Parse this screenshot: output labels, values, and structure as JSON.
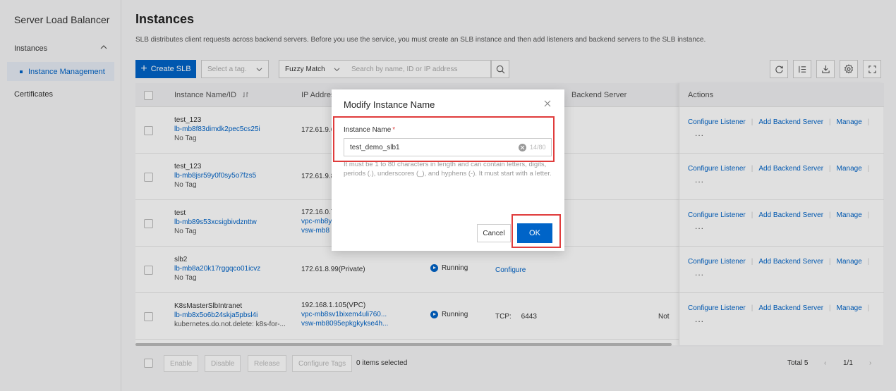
{
  "sidebar": {
    "title": "Server Load Balancer",
    "group": "Instances",
    "active_item": "Instance Management",
    "item_certificates": "Certificates"
  },
  "page": {
    "title": "Instances",
    "description": "SLB distributes client requests across backend servers. Before you use the service, you must create an SLB instance and then add listeners and backend servers to the SLB instance."
  },
  "toolbar": {
    "create_label": "Create SLB",
    "tag_placeholder": "Select a tag.",
    "match_mode": "Fuzzy Match",
    "search_placeholder": "Search by name, ID or IP address",
    "icons": [
      "refresh-icon",
      "columns-icon",
      "download-icon",
      "settings-icon",
      "fullscreen-icon"
    ]
  },
  "table": {
    "columns": [
      "Instance Name/ID",
      "IP Address",
      "Backend Server",
      "Actions"
    ],
    "rows": [
      {
        "name": "test_123",
        "id": "lb-mb8f83dimdk2pec5cs25i",
        "tag": "No Tag",
        "ip": [
          "172.61.9.6"
        ],
        "status": "",
        "backend": ""
      },
      {
        "name": "test_123",
        "id": "lb-mb8jsr59y0f0sy5o7fzs5",
        "tag": "No Tag",
        "ip": [
          "172.61.9.8"
        ],
        "status": "",
        "backend": ""
      },
      {
        "name": "test",
        "id": "lb-mb89s53xcsigbivdznttw",
        "tag": "No Tag",
        "ip": [
          "172.16.0.7",
          "vpc-mb8y",
          "vsw-mb8"
        ],
        "status": "",
        "backend": ""
      },
      {
        "name": "slb2",
        "id": "lb-mb8a20k17rggqco01icvz",
        "tag": "No Tag",
        "ip": [
          "172.61.8.99(Private)"
        ],
        "status": "Running",
        "backend": "Configure"
      },
      {
        "name": "K8sMasterSlbIntranet",
        "id": "lb-mb8x5o6b24skja5pbsl4i",
        "tag": "kubernetes.do.not.delete: k8s-for-...",
        "ip": [
          "192.168.1.105(VPC)",
          "vpc-mb8sv1bixem4uli760...",
          "vsw-mb8095epkgkykse4h..."
        ],
        "status": "Running",
        "backend": "TCP:     6443",
        "extra": "Not"
      }
    ],
    "actions": [
      "Configure Listener",
      "Add Backend Server",
      "Manage"
    ],
    "more": "..."
  },
  "footer": {
    "buttons": [
      "Enable",
      "Disable",
      "Release",
      "Configure Tags"
    ],
    "selected": "0 items selected",
    "total": "Total 5",
    "page": "1/1"
  },
  "dialog": {
    "title": "Modify Instance Name",
    "field_label": "Instance Name",
    "required_mark": "*",
    "value": "test_demo_slb1",
    "counter": "14/80",
    "hint": "It must be 1 to 80 characters in length and can contain letters, digits, periods (.), underscores (_), and hyphens (-). It must start with a letter.",
    "cancel": "Cancel",
    "ok": "OK"
  },
  "colors": {
    "primary": "#0064c8",
    "highlight": "#e03c3c"
  }
}
